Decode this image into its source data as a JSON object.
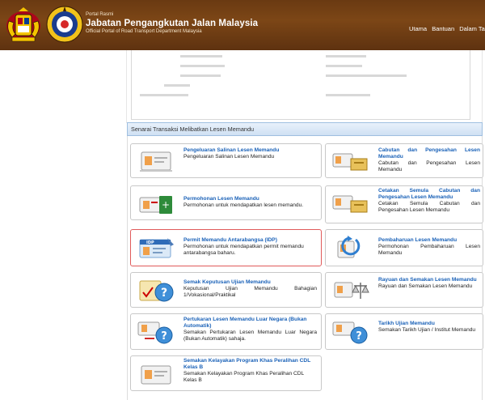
{
  "header": {
    "small_label": "Portal Rasmi",
    "title": "Jabatan Pengangkutan Jalan Malaysia",
    "subtitle": "Official Portal of Road Transport Department Malaysia",
    "nav": [
      "Utama",
      "Bantuan",
      "Dalam Talian"
    ]
  },
  "section": {
    "title": "Senarai Transaksi Melibatkan Lesen Memandu"
  },
  "cards_left": [
    {
      "title": "Pengeluaran Salinan Lesen Memandu",
      "desc": "Pengeluaran Salinan Lesen Memandu"
    },
    {
      "title": "Permohonan Lesen Memandu",
      "desc": "Permohonan untuk mendapatkan lesen memandu."
    },
    {
      "title": "Permit Memandu Antarabangsa (IDP)",
      "desc": "Permohonan untuk mendapatkan permit memandu antarabangsa baharu."
    },
    {
      "title": "Semak Keputusan Ujian Memandu",
      "desc": "Keputusan Ujian Memandu Bahagian 1/Vokasional/Praktikal"
    },
    {
      "title": "Pertukaran Lesen Memandu Luar Negara (Bukan Automatik)",
      "desc": "Semakan Pertukaran Lesen Memandu Luar Negara (Bukan Automatik) sahaja."
    },
    {
      "title": "Semakan Kelayakan Program Khas Peralihan CDL Kelas B",
      "desc": "Semakan Kelayakan Program Khas Peralihan CDL Kelas B"
    }
  ],
  "cards_right": [
    {
      "title": "Cabutan dan Pengesahan Lesen Memandu",
      "desc": "Cabutan dan Pengesahan Lesen Memandu"
    },
    {
      "title": "Cetakan Semula Cabutan dan Pengesahan Lesen Memandu",
      "desc": "Cetakan Semula Cabutan dan Pengesahan Lesen Memandu"
    },
    {
      "title": "Pembaharuan Lesen Memandu",
      "desc": "Permohonan Pembaharuan Lesen Memandu"
    },
    {
      "title": "Rayuan dan Semakan Lesen Memandu",
      "desc": "Rayuan dan Semakan Lesen Memandu"
    },
    {
      "title": "Tarikh Ujian Memandu",
      "desc": "Semakan Tarikh Ujian / Institut Memandu"
    }
  ],
  "colors": {
    "header_brown": "#6a3a12",
    "link_blue": "#1b62b8",
    "highlight_red": "#e05b5b",
    "section_blue": "#cfe0f3"
  },
  "icons": {
    "crest_left": "malaysia-coat-of-arms-icon",
    "crest_right": "jpj-emblem-icon",
    "idp_card": "idp-card-icon"
  },
  "idp_icon_text": "IDP"
}
